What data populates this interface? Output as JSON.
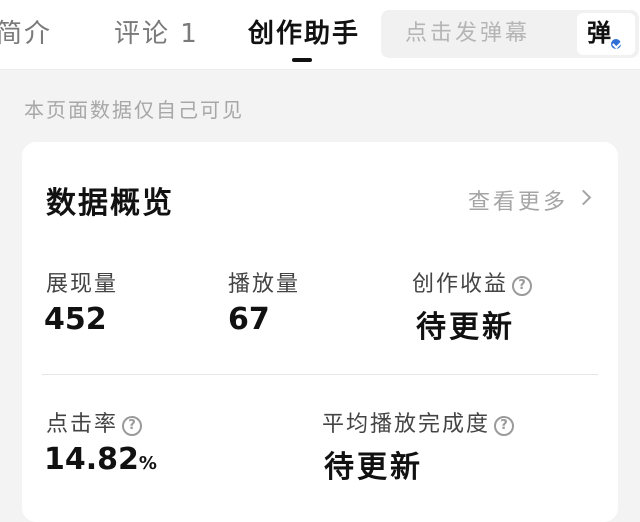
{
  "tabs": {
    "intro": "简介",
    "comments": "评论 1",
    "creator_assistant": "创作助手"
  },
  "danmu": {
    "placeholder": "点击发弹幕",
    "button": "弹"
  },
  "notice": "本页面数据仅自己可见",
  "overview": {
    "title": "数据概览",
    "more": "查看更多",
    "stats": {
      "impressions": {
        "label": "展现量",
        "value": "452"
      },
      "plays": {
        "label": "播放量",
        "value": "67"
      },
      "earnings": {
        "label": "创作收益",
        "value": "待更新"
      },
      "ctr": {
        "label": "点击率",
        "value": "14.82",
        "unit": "%"
      },
      "completion": {
        "label": "平均播放完成度",
        "value": "待更新"
      }
    }
  },
  "colors": {
    "accent_badge": "#2f6fd6",
    "background": "#f3f3f3",
    "card": "#ffffff"
  }
}
